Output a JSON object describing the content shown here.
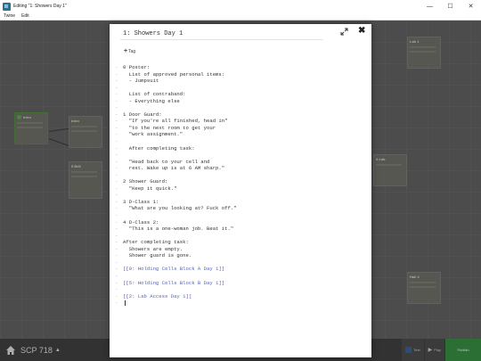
{
  "window": {
    "title": "Editing \"1: Showers Day 1\"",
    "minimize_glyph": "—",
    "maximize_glyph": "☐",
    "close_glyph": "✕"
  },
  "menu": [
    "Twine",
    "Edit"
  ],
  "map": {
    "passages": [
      {
        "title": "Intro"
      },
      {
        "title": "Intro"
      },
      {
        "title": "5 Bell"
      },
      {
        "title": "Lab 1"
      },
      {
        "title": "3 Lab"
      },
      {
        "title": "Hall 2"
      }
    ]
  },
  "bottom_bar": {
    "story_name": "SCP 718",
    "caret": "▲",
    "buttons": [
      {
        "label": "Test"
      },
      {
        "label": "Play"
      },
      {
        "label": "Publish"
      }
    ]
  },
  "dialog": {
    "title": "1: Showers Day 1",
    "tag_label": "Tag",
    "tag_plus": "+",
    "close_glyph": "✖",
    "lines": [
      "0 Poster:",
      "  List of approved personal items:",
      "  - Jumpsuit",
      "",
      "  List of contraband:",
      "  - Everything else",
      "",
      "1 Door Guard:",
      "  \"If you're all finished, head in\"",
      "  \"to the next room to get your",
      "  \"work assignment.\"",
      "",
      "  After completing task:",
      "",
      "  \"Head back to your cell and",
      "  rest. Wake up is at 6 AM sharp.\"",
      "",
      "2 Shower Guard:",
      "  \"Keep it quick.\"",
      "",
      "3 D-Class 1:",
      "  \"What are you looking at? Fuck off.\"",
      "",
      "4 D-Class 2:",
      "  \"This is a one-woman job. Beat it.\"",
      "",
      "After completing task:",
      "  Showers are empty.",
      "  Shower guard is gone.",
      "",
      "[[0: Holding Cells Block A Day 1]]",
      "",
      "[[5: Holding Cells Block B Day 1]]",
      "",
      "[[2: Lab Access Day 1]]",
      ""
    ],
    "gutter_glyph": "-"
  }
}
